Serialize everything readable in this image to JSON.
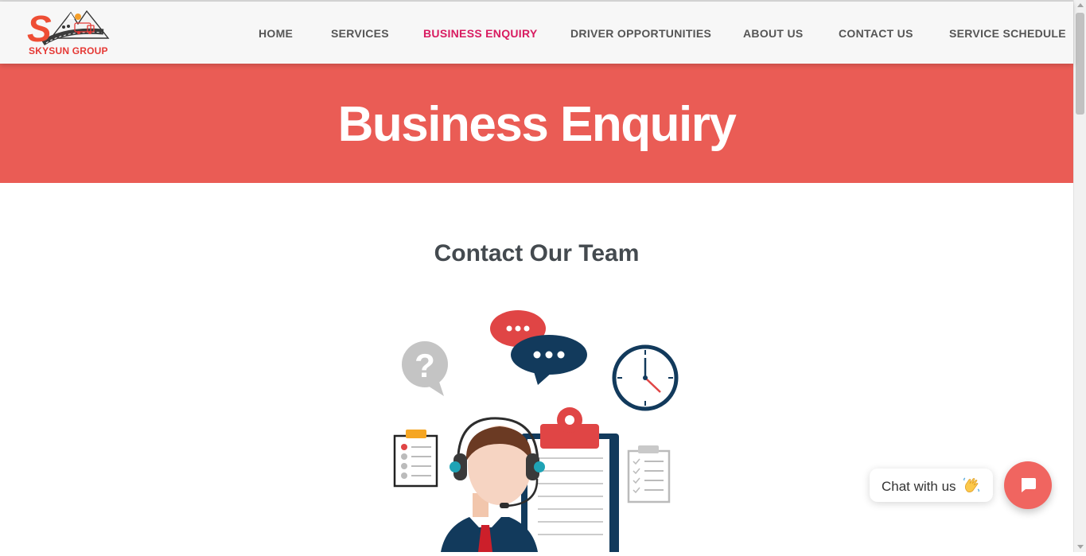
{
  "brand": {
    "name": "SKYSUN GROUP",
    "logo_glyph": "S"
  },
  "nav": {
    "items": [
      {
        "label": "HOME",
        "active": false
      },
      {
        "label": "SERVICES",
        "active": false
      },
      {
        "label": "BUSINESS ENQUIRY",
        "active": true
      },
      {
        "label": "DRIVER OPPORTUNITIES",
        "active": false
      },
      {
        "label": "ABOUT US",
        "active": false
      },
      {
        "label": "CONTACT US",
        "active": false
      },
      {
        "label": "SERVICE SCHEDULE",
        "active": false
      }
    ]
  },
  "hero": {
    "title": "Business Enquiry"
  },
  "main": {
    "section_title": "Contact Our Team"
  },
  "illustration": {
    "question_mark": "?"
  },
  "chat": {
    "label": "Chat with us",
    "emoji_icon": "waving-hand-icon",
    "button_icon": "chat-icon"
  },
  "colors": {
    "accent": "#d81b60",
    "hero": "#ea5c55",
    "chat": "#f06560",
    "navy": "#123a5c"
  }
}
